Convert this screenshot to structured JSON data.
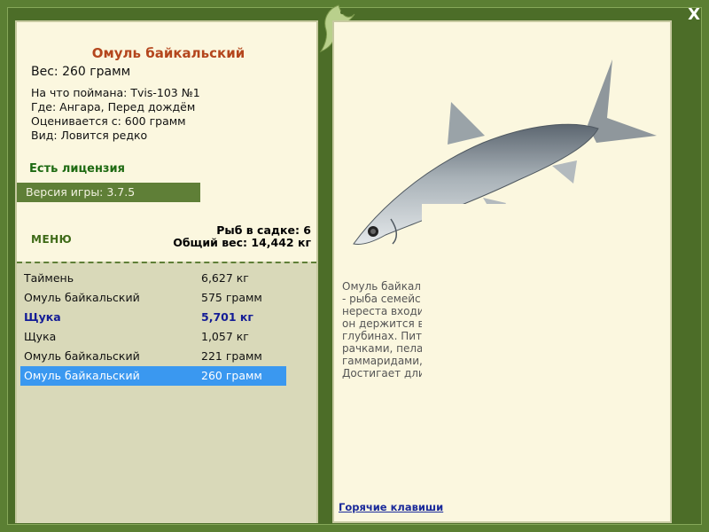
{
  "fish": {
    "title": "Омуль байкальский",
    "weight": "Вес: 260 грамм",
    "caught_on": "На что поймана: Tvis-103 №1",
    "where": "Где: Ангара, Перед дождём",
    "valued_from": "Оценивается с: 600 грамм",
    "kind": "Вид: Ловится редко",
    "license": "Есть лицензия",
    "version": "Версия игры: 3.7.5"
  },
  "menu_label": "МЕНЮ",
  "stats": {
    "fish_in_cage": "Рыб в садке: 6",
    "total_weight": "Общий вес: 14,442 кг"
  },
  "catch_list": [
    {
      "name": "Таймень",
      "weight": "6,627 кг"
    },
    {
      "name": "Омуль байкальский",
      "weight": "575 грамм"
    },
    {
      "name": "Щука",
      "weight": "5,701 кг"
    },
    {
      "name": "Щука",
      "weight": "1,057 кг"
    },
    {
      "name": "Омуль байкальский",
      "weight": "221 грамм"
    },
    {
      "name": "Омуль байкальский",
      "weight": "260 грамм"
    }
  ],
  "description": {
    "line1": "Омуль байкал                                        igratorius)",
    "line2": "- рыба семейс                                        кале, а для",
    "line3": "нереста входи                                       ы). Летом",
    "line4": "он держится в                                       ммой - на",
    "line5": "глубинах. Пит                                       ими",
    "line6": "рачками, пела",
    "line7": "гаммаридами,                                        ми рыб.",
    "line8": "Достигает дли"
  },
  "hotkeys_label": "Горячие клавиши",
  "close_label": "X",
  "colors": {
    "frame": "#5b7f33",
    "panel": "#fbf7df",
    "title": "#b4461d",
    "license": "#1e6a12",
    "highlight": "#141c96",
    "selected": "#3a98f0"
  }
}
